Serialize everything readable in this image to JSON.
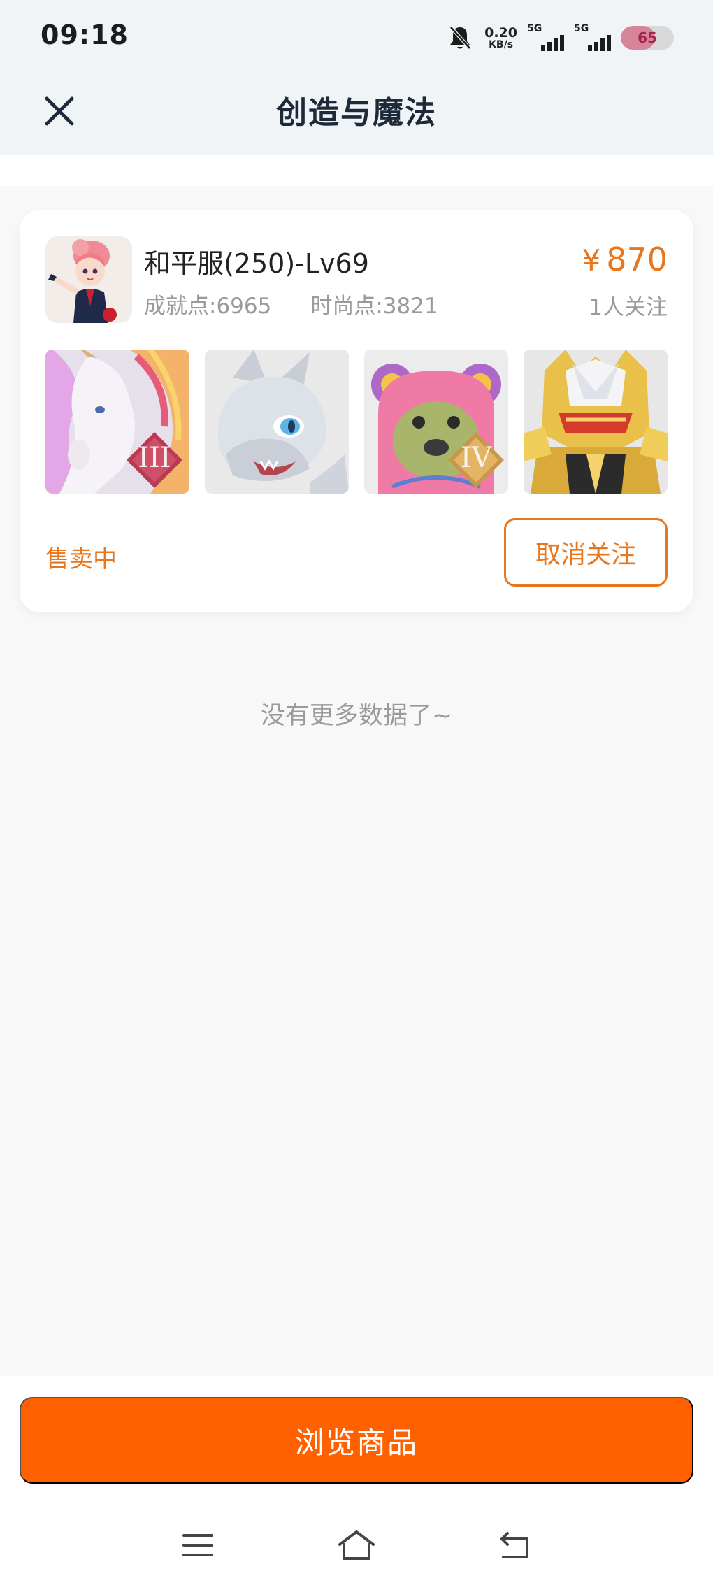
{
  "status_bar": {
    "time": "09:18",
    "net_speed_value": "0.20",
    "net_speed_unit": "KB/s",
    "sim1_label": "5G",
    "sim2_label": "5G",
    "battery_level": "65",
    "battery_fraction": 0.65
  },
  "header": {
    "title": "创造与魔法",
    "close_icon": "close-icon"
  },
  "listing": {
    "title": "和平服(250)-Lv69",
    "achievement": "成就点:6965",
    "fashion": "时尚点:3821",
    "currency": "¥",
    "price": "870",
    "followers": "1人关注",
    "status": "售卖中",
    "unfollow_label": "取消关注",
    "thumbnails": [
      {
        "name": "unicorn-mount",
        "badge": "III"
      },
      {
        "name": "white-dragon-pet",
        "badge": ""
      },
      {
        "name": "pink-bear-outfit",
        "badge": "IV"
      },
      {
        "name": "golden-armor",
        "badge": ""
      }
    ]
  },
  "list_end_text": "没有更多数据了~",
  "browse_button_label": "浏览商品",
  "colors": {
    "accent": "#e8761c",
    "primary_button": "#ff6000",
    "header_bg": "#f1f4f7"
  },
  "system_nav": {
    "menu": "menu-icon",
    "home": "home-icon",
    "back": "back-icon"
  }
}
